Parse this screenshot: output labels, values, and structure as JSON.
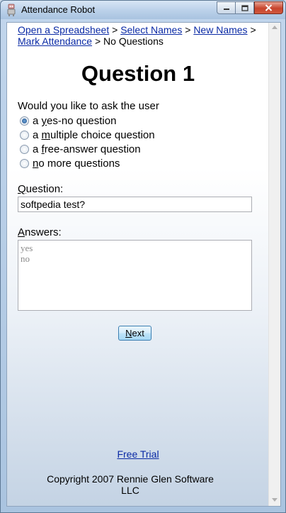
{
  "window": {
    "title": "Attendance Robot"
  },
  "breadcrumb": {
    "links": [
      "Open a Spreadsheet",
      "Select Names",
      "New Names",
      "Mark Attendance"
    ],
    "separator": ">",
    "current": "No Questions"
  },
  "page": {
    "title": "Question 1",
    "prompt": "Would you like to ask the user"
  },
  "options": [
    {
      "prefix": "a ",
      "key": "y",
      "rest": "es-no question",
      "checked": true
    },
    {
      "prefix": "a ",
      "key": "m",
      "rest": "ultiple choice question",
      "checked": false
    },
    {
      "prefix": "a ",
      "key": "f",
      "rest": "ree-answer question",
      "checked": false
    },
    {
      "prefix": "",
      "key": "n",
      "rest": "o more questions",
      "checked": false
    }
  ],
  "question": {
    "label_key": "Q",
    "label_rest": "uestion:",
    "value": "softpedia test?"
  },
  "answers": {
    "label_key": "A",
    "label_rest": "nswers:",
    "lines": [
      "yes",
      "no"
    ]
  },
  "next_button": {
    "key": "N",
    "rest": "ext"
  },
  "footer": {
    "free_trial": "Free Trial",
    "copyright_line1": "Copyright 2007 Rennie Glen Software",
    "copyright_line2": "LLC"
  },
  "colors": {
    "link": "#0a2aa5",
    "close_button": "#c7442d"
  }
}
